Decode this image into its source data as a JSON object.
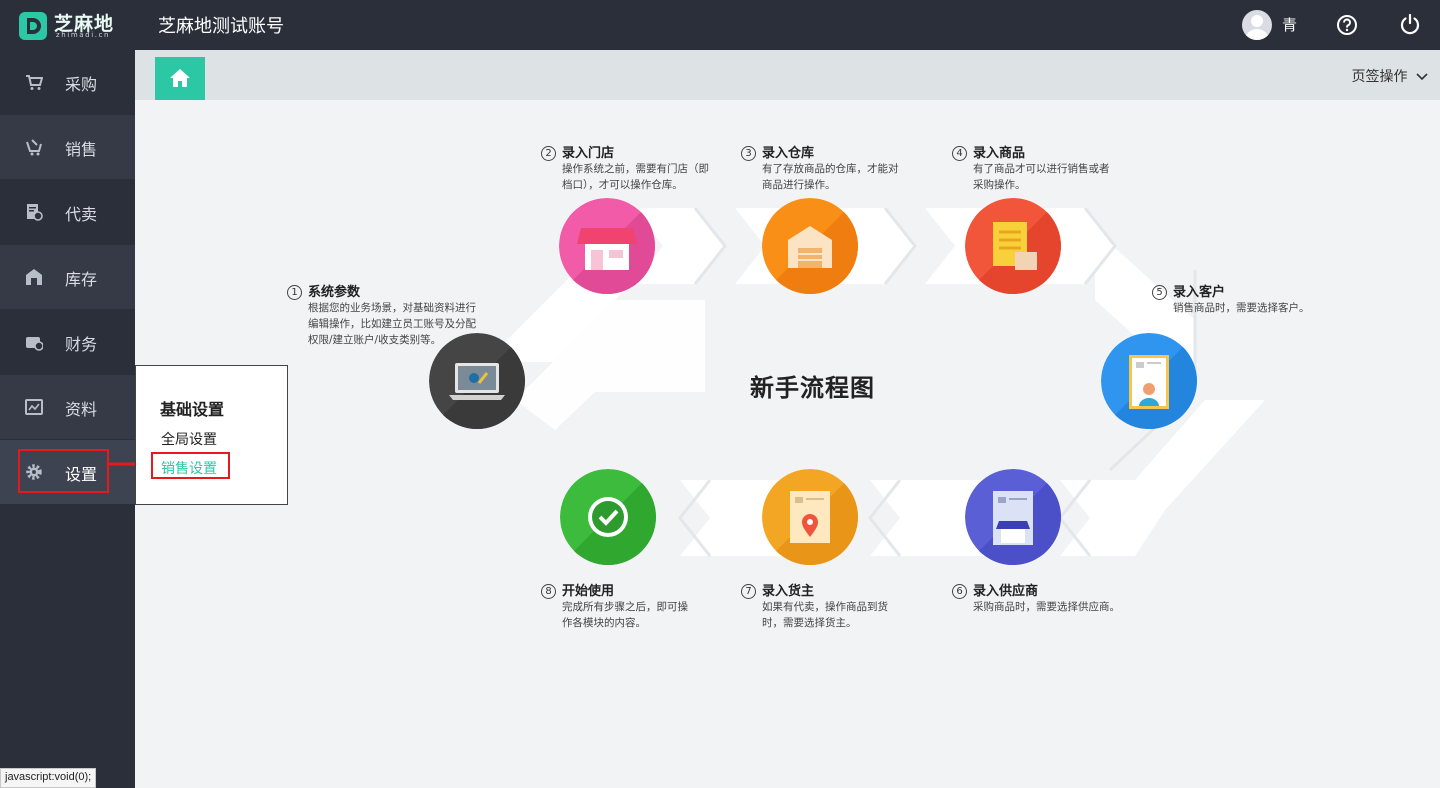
{
  "header": {
    "logo_text": "芝麻地",
    "logo_sub": "zhimadi.cn",
    "account_name": "芝麻地测试账号",
    "user_name": "青"
  },
  "sidebar": {
    "items": [
      {
        "label": "采购",
        "icon": "cart-icon"
      },
      {
        "label": "销售",
        "icon": "sale-cart-icon"
      },
      {
        "label": "代卖",
        "icon": "consign-icon"
      },
      {
        "label": "库存",
        "icon": "warehouse-icon"
      },
      {
        "label": "财务",
        "icon": "finance-icon"
      },
      {
        "label": "资料",
        "icon": "data-icon"
      },
      {
        "label": "设置",
        "icon": "gear-icon"
      }
    ]
  },
  "tabs": {
    "ops_label": "页签操作"
  },
  "popup": {
    "title": "基础设置",
    "links": [
      "全局设置",
      "销售设置"
    ]
  },
  "flow": {
    "title": "新手流程图",
    "steps": [
      {
        "num": "1",
        "title": "系统参数",
        "desc": [
          "根据您的业务场景，对基础资料进行",
          "编辑操作，比如建立员工账号及分配",
          "权限/建立账户/收支类别等。"
        ]
      },
      {
        "num": "2",
        "title": "录入门店",
        "desc": [
          "操作系统之前，需要有门店（即",
          "档口），才可以操作仓库。"
        ]
      },
      {
        "num": "3",
        "title": "录入仓库",
        "desc": [
          "有了存放商品的仓库，才能对",
          "商品进行操作。"
        ]
      },
      {
        "num": "4",
        "title": "录入商品",
        "desc": [
          "有了商品才可以进行销售或者",
          "采购操作。"
        ]
      },
      {
        "num": "5",
        "title": "录入客户",
        "desc": [
          "销售商品时，需要选择客户。"
        ]
      },
      {
        "num": "6",
        "title": "录入供应商",
        "desc": [
          "采购商品时，需要选择供应商。"
        ]
      },
      {
        "num": "7",
        "title": "录入货主",
        "desc": [
          "如果有代卖，操作商品到货",
          "时，需要选择货主。"
        ]
      },
      {
        "num": "8",
        "title": "开始使用",
        "desc": [
          "完成所有步骤之后，即可操",
          "作各模块的内容。"
        ]
      }
    ]
  },
  "status_bar": {
    "url": "javascript:void(0);"
  },
  "colors": {
    "topbar": "#2b2f3a",
    "accent": "#2cc7a5",
    "highlight": "#e8191c"
  }
}
